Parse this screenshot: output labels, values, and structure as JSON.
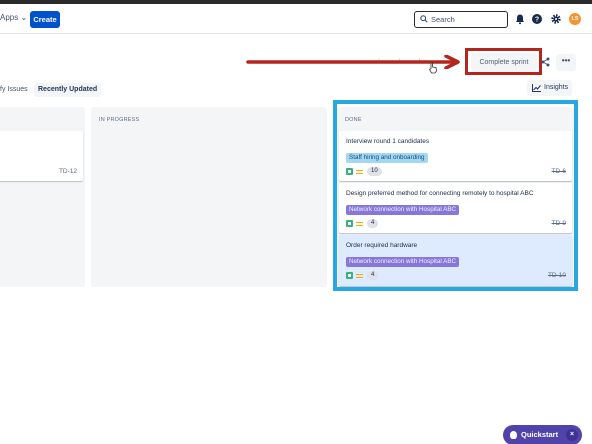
{
  "topbar": {
    "apps_label": "Apps",
    "create_label": "Create",
    "search_placeholder": "Search",
    "avatar_initials": "LS",
    "icons": [
      "notifications-icon",
      "help-icon",
      "settings-icon"
    ]
  },
  "board_header": {
    "complete_sprint_label": "Complete sprint",
    "more_label": "•••",
    "hint_dots": "· · ·"
  },
  "filters": {
    "my_issues_label": "fy Issues",
    "recently_updated_label": "Recently Updated",
    "insights_label": "Insights"
  },
  "columns": {
    "todo": {
      "cards": [
        {
          "key": "TD-12"
        }
      ]
    },
    "in_progress": {
      "title": "IN PROGRESS"
    },
    "done": {
      "title": "DONE",
      "cards": [
        {
          "title": "Interview round 1 candidates",
          "epic": "Staff hiring and onboarding",
          "points": "10",
          "key": "TD-6"
        },
        {
          "title": "Design preferred method for connecting remotely to hospital ABC",
          "epic": "Network connection with Hospital ABC",
          "points": "4",
          "key": "TD-9"
        },
        {
          "title": "Order required hardware",
          "epic": "Network connection with Hospital ABC",
          "points": "4",
          "key": "TD-10"
        }
      ]
    }
  },
  "quickstart": {
    "label": "Quickstart",
    "close_label": "×"
  },
  "annotations": {
    "arrow_color": "#b3261e",
    "box_color": "#b3261e",
    "done_box_color": "#29a8e0"
  }
}
